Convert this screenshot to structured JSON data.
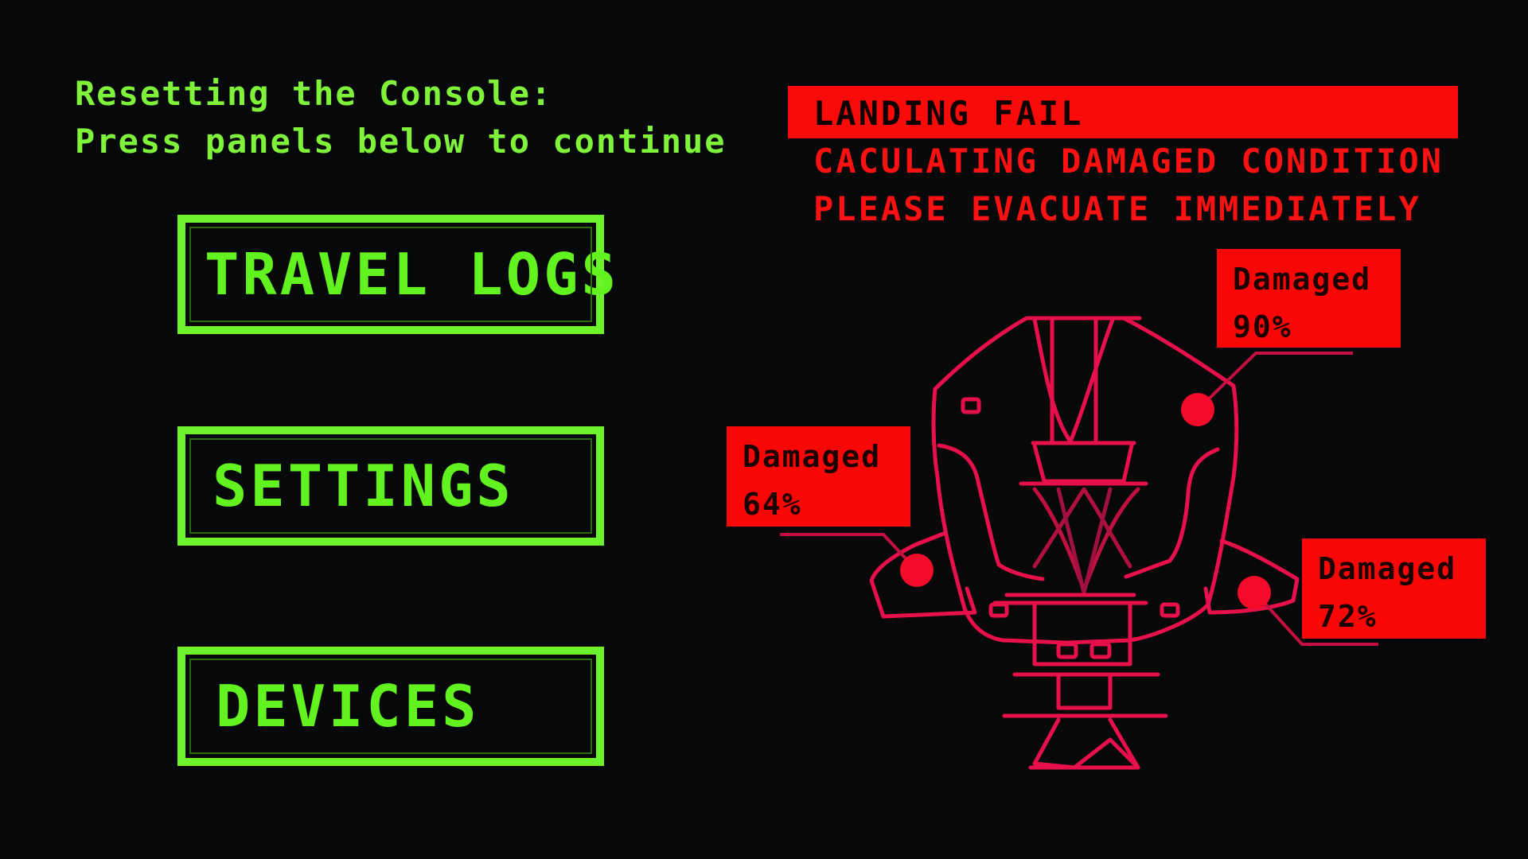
{
  "console": {
    "instruction_line1": "Resetting the Console:",
    "instruction_line2": "Press panels below to continue"
  },
  "panels": {
    "travel_logs": "TRAVEL LOGS",
    "settings": "SETTINGS",
    "devices": "DEVICES"
  },
  "alerts": {
    "title": "LANDING FAIL",
    "line2": "CACULATING DAMAGED CONDITION",
    "line3": "PLEASE EVACUATE IMMEDIATELY"
  },
  "damage_reports": [
    {
      "label": "Damaged",
      "value": "90%",
      "location": "right-upper"
    },
    {
      "label": "Damaged",
      "value": "64%",
      "location": "left-wing"
    },
    {
      "label": "Damaged",
      "value": "72%",
      "location": "right-wing"
    }
  ],
  "colors": {
    "background": "#070809",
    "console_green": "#6df22b",
    "alert_red": "#fb0a0a",
    "ship_outline": "#e8104a"
  }
}
